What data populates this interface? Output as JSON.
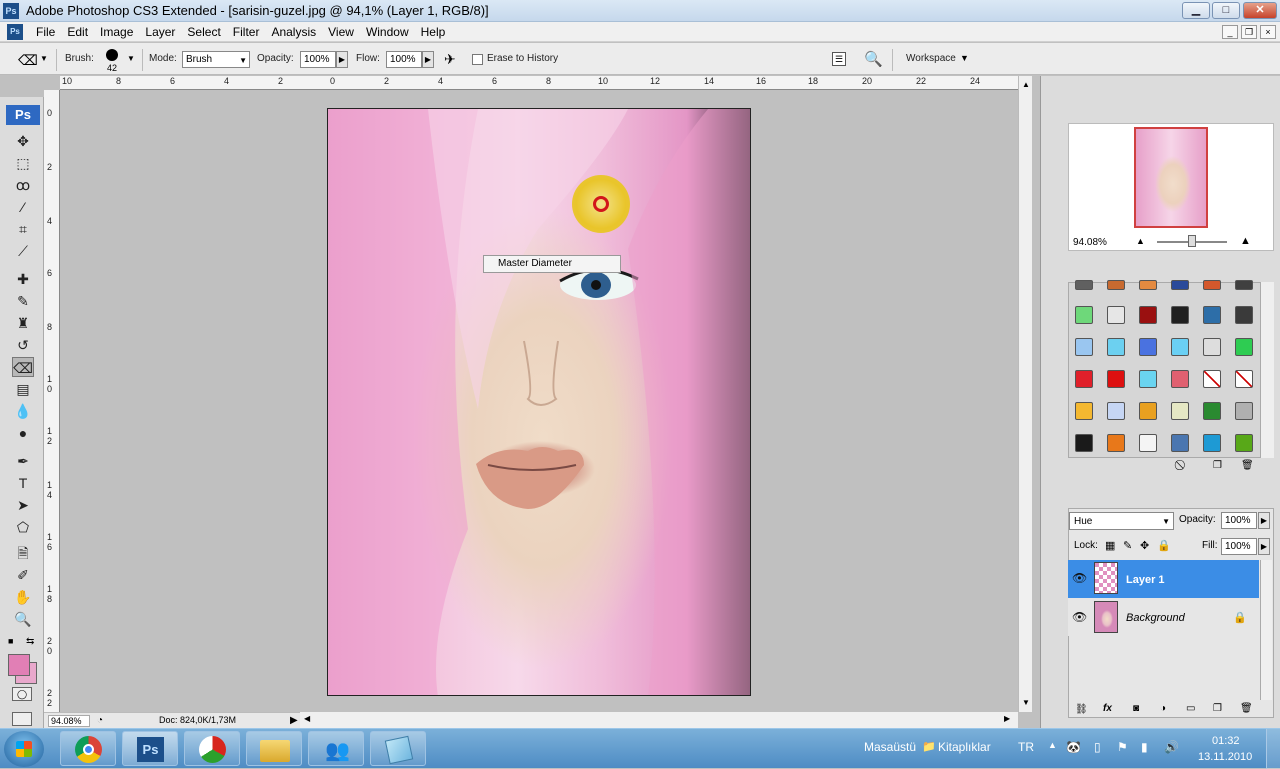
{
  "window": {
    "title": "Adobe Photoshop CS3 Extended - [sarisin-guzel.jpg @ 94,1% (Layer 1, RGB/8)]",
    "app_badge": "Ps",
    "controls": {
      "minimize": "▁",
      "maximize": "□",
      "close": "✕",
      "doc_minimize": "_",
      "doc_restore": "❐",
      "doc_close": "×"
    }
  },
  "menu": [
    "File",
    "Edit",
    "Image",
    "Layer",
    "Select",
    "Filter",
    "Analysis",
    "View",
    "Window",
    "Help"
  ],
  "options": {
    "brush_label": "Brush:",
    "brush_size": "42",
    "mode_label": "Mode:",
    "mode_value": "Brush",
    "opacity_label": "Opacity:",
    "opacity_value": "100%",
    "flow_label": "Flow:",
    "flow_value": "100%",
    "erase_history": "Erase to History",
    "workspace": "Workspace"
  },
  "rulers": {
    "top": [
      "10",
      "8",
      "6",
      "4",
      "2",
      "0",
      "2",
      "4",
      "6",
      "8",
      "10",
      "12",
      "14",
      "16",
      "18",
      "20",
      "22",
      "24"
    ],
    "left": [
      "0",
      "2",
      "4",
      "6",
      "8",
      "1 0",
      "1 2",
      "1 4",
      "1 6",
      "1 8",
      "2 0",
      "2 2"
    ]
  },
  "canvas": {
    "tooltip": "Master Diameter"
  },
  "status": {
    "zoom": "94.08%",
    "doc": "Doc: 824,0K/1,73M"
  },
  "navigator": {
    "zoom": "94.08%"
  },
  "layers": {
    "blend_mode": "Hue",
    "opacity_label": "Opacity:",
    "opacity_value": "100%",
    "lock_label": "Lock:",
    "fill_label": "Fill:",
    "fill_value": "100%",
    "items": [
      {
        "name": "Layer 1",
        "selected": true
      },
      {
        "name": "Background",
        "locked": true
      }
    ]
  },
  "styles_colors": [
    [
      "#606060",
      "#c86a30",
      "#e48a40",
      "#2a4a9a",
      "#d4582c",
      "#404040"
    ],
    [
      "#6ed87a",
      "#e6e6e6",
      "#9a1010",
      "#202020",
      "#2d6ea8",
      "#3a3a3a"
    ],
    [
      "#9ac6f0",
      "#6cd0f0",
      "#4a72e0",
      "#6ad0f4",
      "#dddddd",
      "#2ecc52"
    ],
    [
      "#e0202a",
      "#dd1010",
      "#6ad4f0",
      "#e06070",
      "#ffffff",
      "#ffffff"
    ],
    [
      "#f4b830",
      "#c6d6f4",
      "#e8a020",
      "#e6e8c4",
      "#2a8a30",
      "#b0b0b0"
    ],
    [
      "#1a1a1a",
      "#e8781a",
      "#f4f4f4",
      "#4a76b0",
      "#1e9ad4",
      "#58a818"
    ]
  ],
  "taskbar": {
    "apps": [
      "chrome",
      "photoshop",
      "beach-ball",
      "folder",
      "contacts",
      "notepad"
    ],
    "locale": "TR",
    "desktop": "Masaüstü",
    "library": "Kitaplıklar",
    "time": "01:32",
    "date": "13.11.2010"
  }
}
